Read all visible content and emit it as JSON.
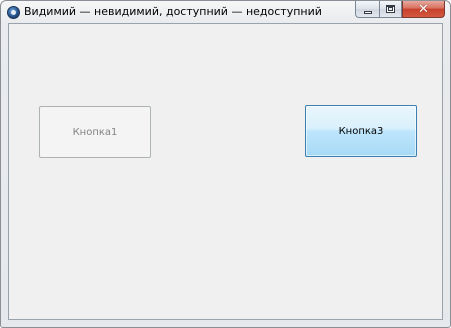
{
  "window": {
    "title": "Видимий — невидимий, доступний — недоступний",
    "icon": "app-globe-icon"
  },
  "caption_buttons": {
    "minimize_icon": "minimize-icon",
    "maximize_icon": "maximize-icon",
    "close_icon": "close-icon"
  },
  "buttons": [
    {
      "label": "Кнопка1",
      "enabled": false
    },
    {
      "label": "Кнопка3",
      "enabled": true
    }
  ],
  "colors": {
    "client_background": "#f0f0f0",
    "active_button_border": "#3c7fb1",
    "active_button_fill": "#bee6fd",
    "close_button": "#c8412c",
    "disabled_text": "#838383"
  }
}
